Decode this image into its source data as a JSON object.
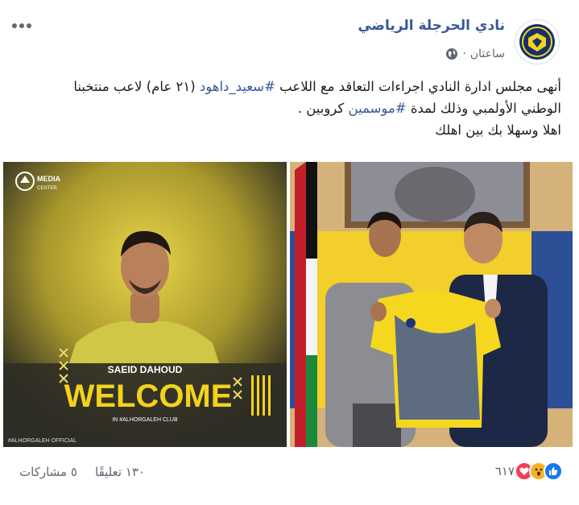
{
  "post": {
    "page_name": "نادي الحرجلة الرياضي",
    "time": "ساعتان",
    "meta_separator": "·",
    "privacy_icon": "globe-icon",
    "more_icon": "ellipsis-icon",
    "lines": {
      "l1_a": "أنهى مجلس ادارة النادي اجراءات التعاقد مع اللاعب ",
      "l1_tag": "#سعيد_داهود",
      "l1_b": " (٢١ عام) لاعب منتخبنا",
      "l2_a": "الوطني الأولمبي وذلك لمدة ",
      "l2_tag": "#موسمين",
      "l2_b": " كروبين .",
      "l3": "اهلا وسهلا بك بين اهلك"
    }
  },
  "photo1": {
    "media_label": "MEDIA",
    "center_label": "CENTER",
    "player_name": "SAEID DAHOUD",
    "welcome": "WELCOME",
    "club_line": "IN #ALHORGALEH CLUB",
    "handle": "#ALHORGALEH OFFICIAL"
  },
  "footer": {
    "reaction_count": "٦١٧",
    "comments": "١٣٠ تعليقًا",
    "shares": "٥ مشاركات",
    "reaction_icons": [
      "like-icon",
      "wow-icon",
      "love-icon"
    ]
  },
  "colors": {
    "link": "#385898",
    "like": "#1877f2",
    "love": "#f33e58",
    "wow": "#f7b125",
    "brand_yellow": "#f2d31b"
  }
}
